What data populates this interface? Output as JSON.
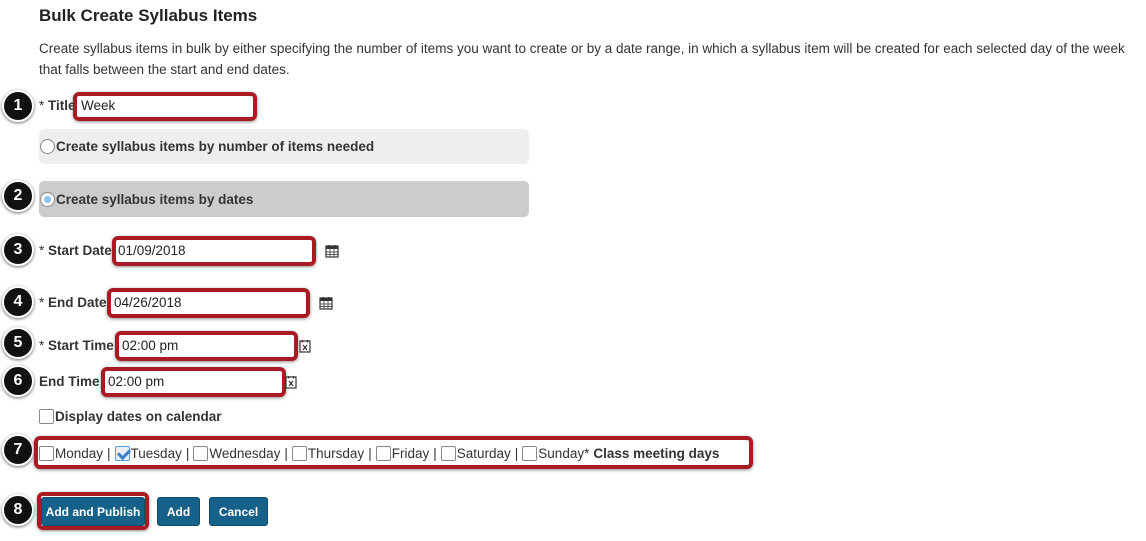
{
  "page": {
    "title": "Bulk Create Syllabus Items",
    "description": "Create syllabus items in bulk by either specifying the number of items you want to create or by a date range, in which a syllabus item will be created for each selected day of the week that falls between the start and end dates."
  },
  "callouts": [
    "1",
    "2",
    "3",
    "4",
    "5",
    "6",
    "7",
    "8"
  ],
  "form": {
    "title_label": "Title",
    "title_value": "Week",
    "required_mark": "*",
    "option_by_number": "Create syllabus items by number of items needed",
    "option_by_dates": "Create syllabus items by dates",
    "selected_option": "Create syllabus items by dates",
    "start_date_label": "Start Date",
    "start_date_value": "01/09/2018",
    "end_date_label": "End Date",
    "end_date_value": "04/26/2018",
    "start_time_label": "Start Time",
    "start_time_value": "02:00 pm",
    "end_time_label": "End Time",
    "end_time_value": "02:00 pm",
    "display_on_calendar_label": "Display dates on calendar",
    "display_on_calendar_checked": false,
    "days": [
      {
        "label": "Monday",
        "checked": false
      },
      {
        "label": "Tuesday",
        "checked": true
      },
      {
        "label": "Wednesday",
        "checked": false
      },
      {
        "label": "Thursday",
        "checked": false
      },
      {
        "label": "Friday",
        "checked": false
      },
      {
        "label": "Saturday",
        "checked": false
      },
      {
        "label": "Sunday",
        "checked": false
      }
    ],
    "days_separator": "|",
    "days_suffix_label": "Class meeting days"
  },
  "buttons": {
    "add_and_publish": "Add and Publish",
    "add": "Add",
    "cancel": "Cancel"
  },
  "colors": {
    "highlight": "#a81b23",
    "button": "#15618a",
    "callout": "#111111"
  },
  "icons": {
    "date_picker": "calendar-icon",
    "time_picker": "clock-icon"
  }
}
